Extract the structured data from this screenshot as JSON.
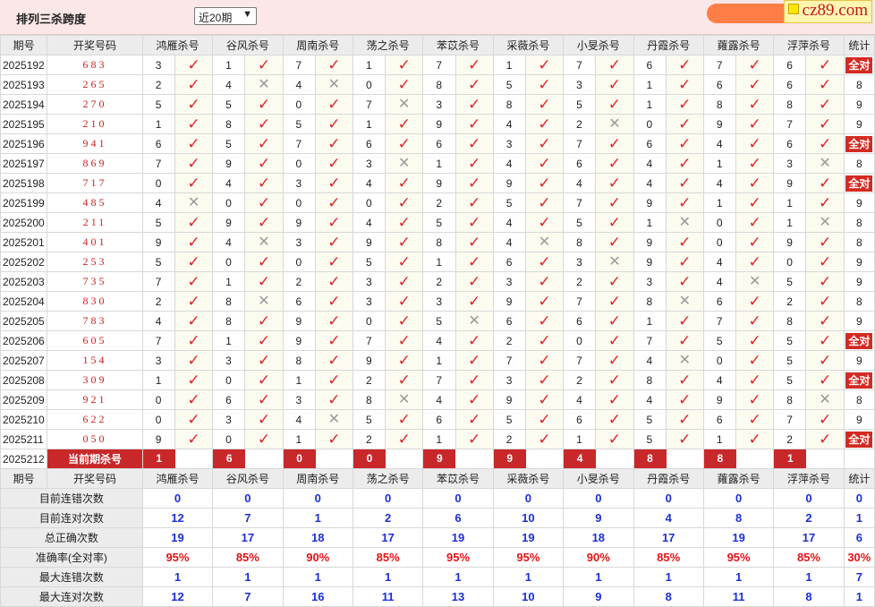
{
  "header": {
    "title": "排列三杀跨度",
    "period_select": "近20期",
    "logo_text": "cz89.com"
  },
  "columns": {
    "issue": "期号",
    "draw": "开奖号码",
    "experts": [
      "鸿雁杀号",
      "谷风杀号",
      "周南杀号",
      "荡之杀号",
      "苯苡杀号",
      "采薇杀号",
      "小旻杀号",
      "丹霞杀号",
      "蕹露杀号",
      "浮萍杀号"
    ],
    "stats": "统计"
  },
  "all_correct_label": "全对",
  "rows": [
    {
      "issue": "2025192",
      "draw": "683",
      "k": [
        3,
        1,
        7,
        1,
        7,
        1,
        7,
        6,
        7,
        6
      ],
      "r": [
        1,
        1,
        1,
        1,
        1,
        1,
        1,
        1,
        1,
        1
      ],
      "stat": "全对"
    },
    {
      "issue": "2025193",
      "draw": "265",
      "k": [
        2,
        4,
        4,
        0,
        8,
        5,
        3,
        1,
        6,
        6
      ],
      "r": [
        1,
        0,
        0,
        1,
        1,
        1,
        1,
        1,
        1,
        1
      ],
      "stat": "8"
    },
    {
      "issue": "2025194",
      "draw": "270",
      "k": [
        5,
        5,
        0,
        7,
        3,
        8,
        5,
        1,
        8,
        8
      ],
      "r": [
        1,
        1,
        1,
        0,
        1,
        1,
        1,
        1,
        1,
        1
      ],
      "stat": "9"
    },
    {
      "issue": "2025195",
      "draw": "210",
      "k": [
        1,
        8,
        5,
        1,
        9,
        4,
        2,
        0,
        9,
        7
      ],
      "r": [
        1,
        1,
        1,
        1,
        1,
        1,
        0,
        1,
        1,
        1
      ],
      "stat": "9"
    },
    {
      "issue": "2025196",
      "draw": "941",
      "k": [
        6,
        5,
        7,
        6,
        6,
        3,
        7,
        6,
        4,
        6
      ],
      "r": [
        1,
        1,
        1,
        1,
        1,
        1,
        1,
        1,
        1,
        1
      ],
      "stat": "全对"
    },
    {
      "issue": "2025197",
      "draw": "869",
      "k": [
        7,
        9,
        0,
        3,
        1,
        4,
        6,
        4,
        1,
        3
      ],
      "r": [
        1,
        1,
        1,
        0,
        1,
        1,
        1,
        1,
        1,
        0
      ],
      "stat": "8"
    },
    {
      "issue": "2025198",
      "draw": "717",
      "k": [
        0,
        4,
        3,
        4,
        9,
        9,
        4,
        4,
        4,
        9
      ],
      "r": [
        1,
        1,
        1,
        1,
        1,
        1,
        1,
        1,
        1,
        1
      ],
      "stat": "全对"
    },
    {
      "issue": "2025199",
      "draw": "485",
      "k": [
        4,
        0,
        0,
        0,
        2,
        5,
        7,
        9,
        1,
        1
      ],
      "r": [
        0,
        1,
        1,
        1,
        1,
        1,
        1,
        1,
        1,
        1
      ],
      "stat": "9"
    },
    {
      "issue": "2025200",
      "draw": "211",
      "k": [
        5,
        9,
        9,
        4,
        5,
        4,
        5,
        1,
        0,
        1
      ],
      "r": [
        1,
        1,
        1,
        1,
        1,
        1,
        1,
        0,
        1,
        0
      ],
      "stat": "8"
    },
    {
      "issue": "2025201",
      "draw": "401",
      "k": [
        9,
        4,
        3,
        9,
        8,
        4,
        8,
        9,
        0,
        9
      ],
      "r": [
        1,
        0,
        1,
        1,
        1,
        0,
        1,
        1,
        1,
        1
      ],
      "stat": "8"
    },
    {
      "issue": "2025202",
      "draw": "253",
      "k": [
        5,
        0,
        0,
        5,
        1,
        6,
        3,
        9,
        4,
        0
      ],
      "r": [
        1,
        1,
        1,
        1,
        1,
        1,
        0,
        1,
        1,
        1
      ],
      "stat": "9"
    },
    {
      "issue": "2025203",
      "draw": "735",
      "k": [
        7,
        1,
        2,
        3,
        2,
        3,
        2,
        3,
        4,
        5
      ],
      "r": [
        1,
        1,
        1,
        1,
        1,
        1,
        1,
        1,
        0,
        1
      ],
      "stat": "9"
    },
    {
      "issue": "2025204",
      "draw": "830",
      "k": [
        2,
        8,
        6,
        3,
        3,
        9,
        7,
        8,
        6,
        2
      ],
      "r": [
        1,
        0,
        1,
        1,
        1,
        1,
        1,
        0,
        1,
        1
      ],
      "stat": "8"
    },
    {
      "issue": "2025205",
      "draw": "783",
      "k": [
        4,
        8,
        9,
        0,
        5,
        6,
        6,
        1,
        7,
        8
      ],
      "r": [
        1,
        1,
        1,
        1,
        0,
        1,
        1,
        1,
        1,
        1
      ],
      "stat": "9"
    },
    {
      "issue": "2025206",
      "draw": "605",
      "k": [
        7,
        1,
        9,
        7,
        4,
        2,
        0,
        7,
        5,
        5
      ],
      "r": [
        1,
        1,
        1,
        1,
        1,
        1,
        1,
        1,
        1,
        1
      ],
      "stat": "全对"
    },
    {
      "issue": "2025207",
      "draw": "154",
      "k": [
        3,
        3,
        8,
        9,
        1,
        7,
        7,
        4,
        0,
        5
      ],
      "r": [
        1,
        1,
        1,
        1,
        1,
        1,
        1,
        0,
        1,
        1
      ],
      "stat": "9"
    },
    {
      "issue": "2025208",
      "draw": "309",
      "k": [
        1,
        0,
        1,
        2,
        7,
        3,
        2,
        8,
        4,
        5
      ],
      "r": [
        1,
        1,
        1,
        1,
        1,
        1,
        1,
        1,
        1,
        1
      ],
      "stat": "全对"
    },
    {
      "issue": "2025209",
      "draw": "921",
      "k": [
        0,
        6,
        3,
        8,
        4,
        9,
        4,
        4,
        9,
        8
      ],
      "r": [
        1,
        1,
        1,
        0,
        1,
        1,
        1,
        1,
        1,
        0
      ],
      "stat": "8"
    },
    {
      "issue": "2025210",
      "draw": "622",
      "k": [
        0,
        3,
        4,
        5,
        6,
        5,
        6,
        5,
        6,
        7
      ],
      "r": [
        1,
        1,
        0,
        1,
        1,
        1,
        1,
        1,
        1,
        1
      ],
      "stat": "9"
    },
    {
      "issue": "2025211",
      "draw": "050",
      "k": [
        9,
        0,
        1,
        2,
        1,
        2,
        1,
        5,
        1,
        2
      ],
      "r": [
        1,
        1,
        1,
        1,
        1,
        1,
        1,
        1,
        1,
        1
      ],
      "stat": "全对"
    }
  ],
  "current": {
    "issue": "2025212",
    "label": "当前期杀号",
    "kills": [
      "1",
      "6",
      "0",
      "0",
      "9",
      "9",
      "4",
      "8",
      "8",
      "1"
    ]
  },
  "summary": [
    {
      "label": "目前连错次数",
      "values": [
        "0",
        "0",
        "0",
        "0",
        "0",
        "0",
        "0",
        "0",
        "0",
        "0"
      ],
      "total": "0",
      "color": "blue"
    },
    {
      "label": "目前连对次数",
      "values": [
        "12",
        "7",
        "1",
        "2",
        "6",
        "10",
        "9",
        "4",
        "8",
        "2"
      ],
      "total": "1",
      "color": "blue"
    },
    {
      "label": "总正确次数",
      "values": [
        "19",
        "17",
        "18",
        "17",
        "19",
        "19",
        "18",
        "17",
        "19",
        "17"
      ],
      "total": "6",
      "color": "blue"
    },
    {
      "label": "准确率(全对率)",
      "values": [
        "95%",
        "85%",
        "90%",
        "85%",
        "95%",
        "95%",
        "90%",
        "85%",
        "95%",
        "85%"
      ],
      "total": "30%",
      "color": "red"
    },
    {
      "label": "最大连错次数",
      "values": [
        "1",
        "1",
        "1",
        "1",
        "1",
        "1",
        "1",
        "1",
        "1",
        "1"
      ],
      "total": "7",
      "color": "blue"
    },
    {
      "label": "最大连对次数",
      "values": [
        "12",
        "7",
        "16",
        "11",
        "13",
        "10",
        "9",
        "8",
        "11",
        "8"
      ],
      "total": "1",
      "color": "blue"
    }
  ]
}
